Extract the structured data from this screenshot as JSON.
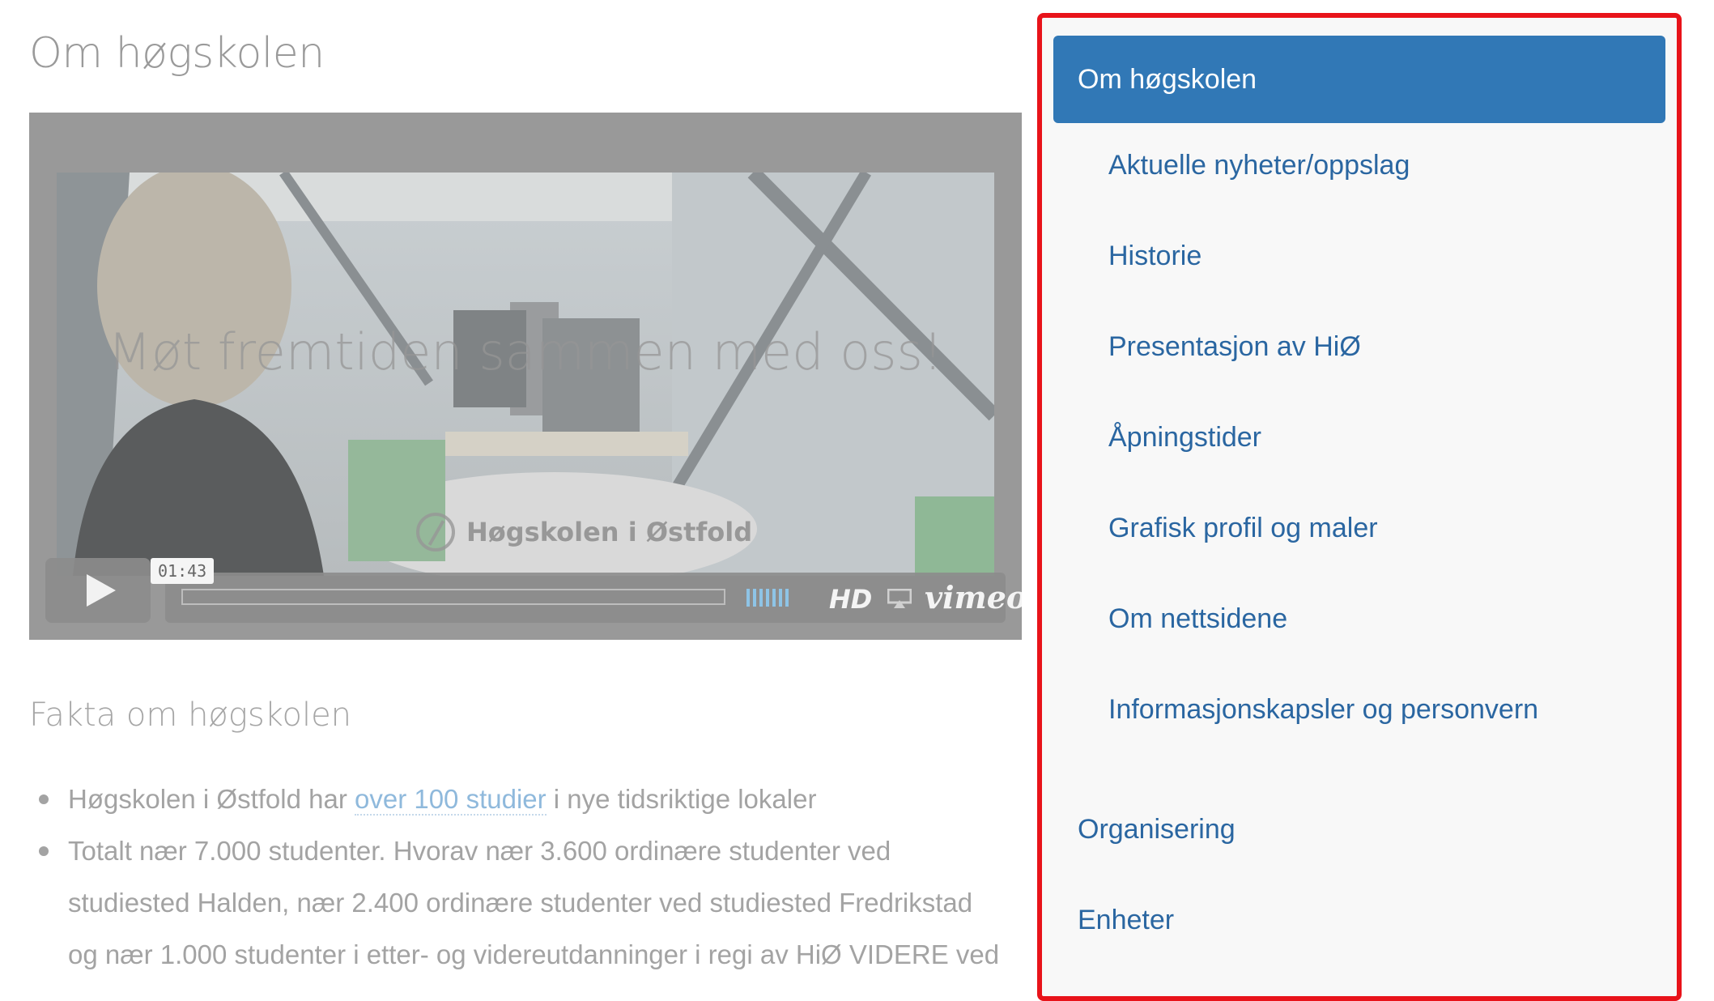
{
  "page": {
    "title": "Om høgskolen"
  },
  "video": {
    "overlay_text": "Møt fremtiden sammen med oss!",
    "logo_text": "Høgskolen i Østfold",
    "time": "01:43",
    "hd_label": "HD",
    "brand_label": "vimeo",
    "icons": [
      "play-icon",
      "volume-icon",
      "airplay-icon"
    ]
  },
  "facts": {
    "heading": "Fakta om høgskolen",
    "item1_before": "Høgskolen i Østfold har ",
    "item1_link": "over 100 studier",
    "item1_after": " i nye tidsriktige lokaler",
    "item2": "Totalt nær 7.000 studenter. Hvorav nær 3.600 ordinære studenter ved studiested Halden,  nær 2.400 ordinære studenter ved studiested Fredrikstad og nær 1.000 studenter i etter- og videreutdanninger i regi av HiØ VIDERE ved"
  },
  "sidebar": {
    "active": "Om høgskolen",
    "subitems": [
      "Aktuelle nyheter/oppslag",
      "Historie",
      "Presentasjon av HiØ",
      "Åpningstider",
      "Grafisk profil og maler",
      "Om nettsidene",
      "Informasjonskapsler og personvern"
    ],
    "topitems": [
      "Organisering",
      "Enheter"
    ]
  },
  "colors": {
    "accent": "#3178b6",
    "link": "#2a66a1",
    "highlight_border": "#e8131a"
  }
}
